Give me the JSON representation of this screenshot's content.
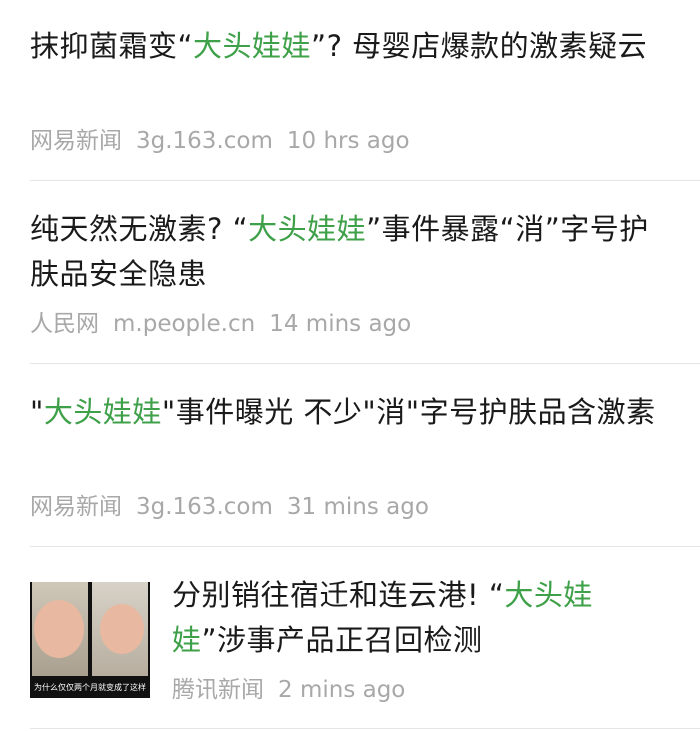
{
  "items": [
    {
      "title_parts": [
        {
          "text": "抹抑菌霜变“",
          "hl": false
        },
        {
          "text": "大头娃娃",
          "hl": true
        },
        {
          "text": "”? 母婴店爆款的激素疑云",
          "hl": false
        }
      ],
      "source": "网易新闻",
      "domain": "3g.163.com",
      "time": "10 hrs ago"
    },
    {
      "title_parts": [
        {
          "text": "纯天然无激素? “",
          "hl": false
        },
        {
          "text": "大头娃娃",
          "hl": true
        },
        {
          "text": "”事件暴露“消”字号护肤品安全隐患",
          "hl": false
        }
      ],
      "source": "人民网",
      "domain": "m.people.cn",
      "time": "14 mins ago"
    },
    {
      "title_parts": [
        {
          "text": "\"",
          "hl": false
        },
        {
          "text": "大头娃娃",
          "hl": true
        },
        {
          "text": "\"事件曝光 不少\"消\"字号护肤品含激素",
          "hl": false
        }
      ],
      "source": "网易新闻",
      "domain": "3g.163.com",
      "time": "31 mins ago"
    },
    {
      "title_parts": [
        {
          "text": "分别销往宿迁和连云港! “",
          "hl": false
        },
        {
          "text": "大头娃娃",
          "hl": true
        },
        {
          "text": "”涉事产品正召回检测",
          "hl": false
        }
      ],
      "source": "腾讯新闻",
      "domain": "",
      "time": "2 mins ago",
      "thumbnail_caption": "为什么仅仅两个月就变成了这样"
    }
  ]
}
